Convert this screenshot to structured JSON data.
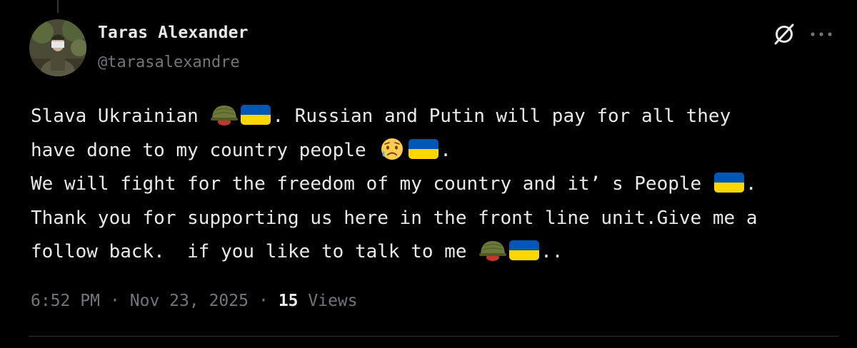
{
  "author": {
    "display_name": "Taras Alexander",
    "handle": "@tarasalexandre",
    "avatar_icon": "soldier-avatar"
  },
  "header_actions": {
    "grok_icon": "grok-icon",
    "more_icon": "more-dots-icon"
  },
  "tweet": {
    "lines": [
      [
        {
          "type": "text",
          "value": "Slava Ukrainian "
        },
        {
          "type": "emoji",
          "value": "military-helmet"
        },
        {
          "type": "emoji",
          "value": "flag-ukraine"
        },
        {
          "type": "text",
          "value": ". Russian and Putin will pay for all they"
        }
      ],
      [
        {
          "type": "text",
          "value": "have done to my country people "
        },
        {
          "type": "emoji",
          "value": "sad-but-relieved-face"
        },
        {
          "type": "emoji",
          "value": "flag-ukraine"
        },
        {
          "type": "text",
          "value": "."
        }
      ],
      [
        {
          "type": "text",
          "value": "We will fight for the freedom of my country and it’ s People "
        },
        {
          "type": "emoji",
          "value": "flag-ukraine"
        },
        {
          "type": "text",
          "value": "."
        }
      ],
      [
        {
          "type": "text",
          "value": "Thank you for supporting us here in the front line unit.Give me a"
        }
      ],
      [
        {
          "type": "text",
          "value": "follow back.  if you like to talk to me "
        },
        {
          "type": "emoji",
          "value": "military-helmet"
        },
        {
          "type": "emoji",
          "value": "flag-ukraine"
        },
        {
          "type": "text",
          "value": ".."
        }
      ]
    ]
  },
  "meta": {
    "time": "6:52 PM",
    "date": "Nov 23, 2025",
    "separator": "·",
    "views_count": "15",
    "views_label": "Views"
  },
  "colors": {
    "background": "#000000",
    "text_primary": "#e7e9ea",
    "text_secondary": "#71767b",
    "divider": "#2f3336",
    "flag_blue": "#0057b7",
    "flag_yellow": "#ffd700"
  }
}
